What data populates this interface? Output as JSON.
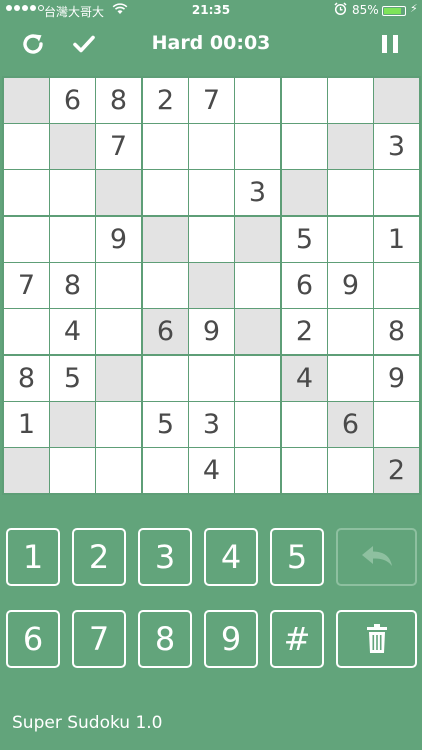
{
  "status_bar": {
    "carrier": "台灣大哥大",
    "time": "21:35",
    "battery": "85%",
    "battery_level": 0.85
  },
  "toolbar": {
    "title": "Hard 00:03",
    "refresh_icon": "refresh-icon",
    "check_icon": "check-icon",
    "pause_icon": "pause-icon"
  },
  "board": {
    "rows": [
      [
        "",
        "6",
        "8",
        "2",
        "7",
        "",
        "",
        "",
        ""
      ],
      [
        "",
        "",
        "7",
        "",
        "",
        "",
        "",
        "",
        "3"
      ],
      [
        "",
        "",
        "",
        "",
        "",
        "3",
        "",
        "",
        ""
      ],
      [
        "",
        "",
        "9",
        "",
        "",
        "",
        "5",
        "",
        "1"
      ],
      [
        "7",
        "8",
        "",
        "",
        "",
        "",
        "6",
        "9",
        ""
      ],
      [
        "",
        "4",
        "",
        "6",
        "9",
        "",
        "2",
        "",
        "8"
      ],
      [
        "8",
        "5",
        "",
        "",
        "",
        "",
        "4",
        "",
        "9"
      ],
      [
        "1",
        "",
        "",
        "5",
        "3",
        "",
        "",
        "6",
        ""
      ],
      [
        "",
        "",
        "",
        "",
        "4",
        "",
        "",
        "",
        "2"
      ]
    ],
    "highlighted": [
      [
        0,
        0
      ],
      [
        0,
        8
      ],
      [
        1,
        1
      ],
      [
        1,
        7
      ],
      [
        2,
        2
      ],
      [
        2,
        6
      ],
      [
        3,
        3
      ],
      [
        3,
        5
      ],
      [
        4,
        4
      ],
      [
        5,
        3
      ],
      [
        5,
        5
      ],
      [
        6,
        2
      ],
      [
        6,
        6
      ],
      [
        7,
        1
      ],
      [
        7,
        7
      ],
      [
        8,
        0
      ],
      [
        8,
        8
      ]
    ],
    "colors": {
      "grid": "#5e9e77",
      "highlight": "#e3e3e3",
      "digit": "#4a4a4a"
    }
  },
  "keypad": {
    "row1": [
      "1",
      "2",
      "3",
      "4",
      "5"
    ],
    "row2": [
      "6",
      "7",
      "8",
      "9",
      "#"
    ],
    "undo_icon": "undo-icon",
    "delete_icon": "trash-icon"
  },
  "footer": {
    "label": "Super Sudoku 1.0"
  },
  "colors": {
    "background": "#62a47b",
    "key_border": "#ffffff",
    "disabled_border": "#8ec0a0"
  }
}
